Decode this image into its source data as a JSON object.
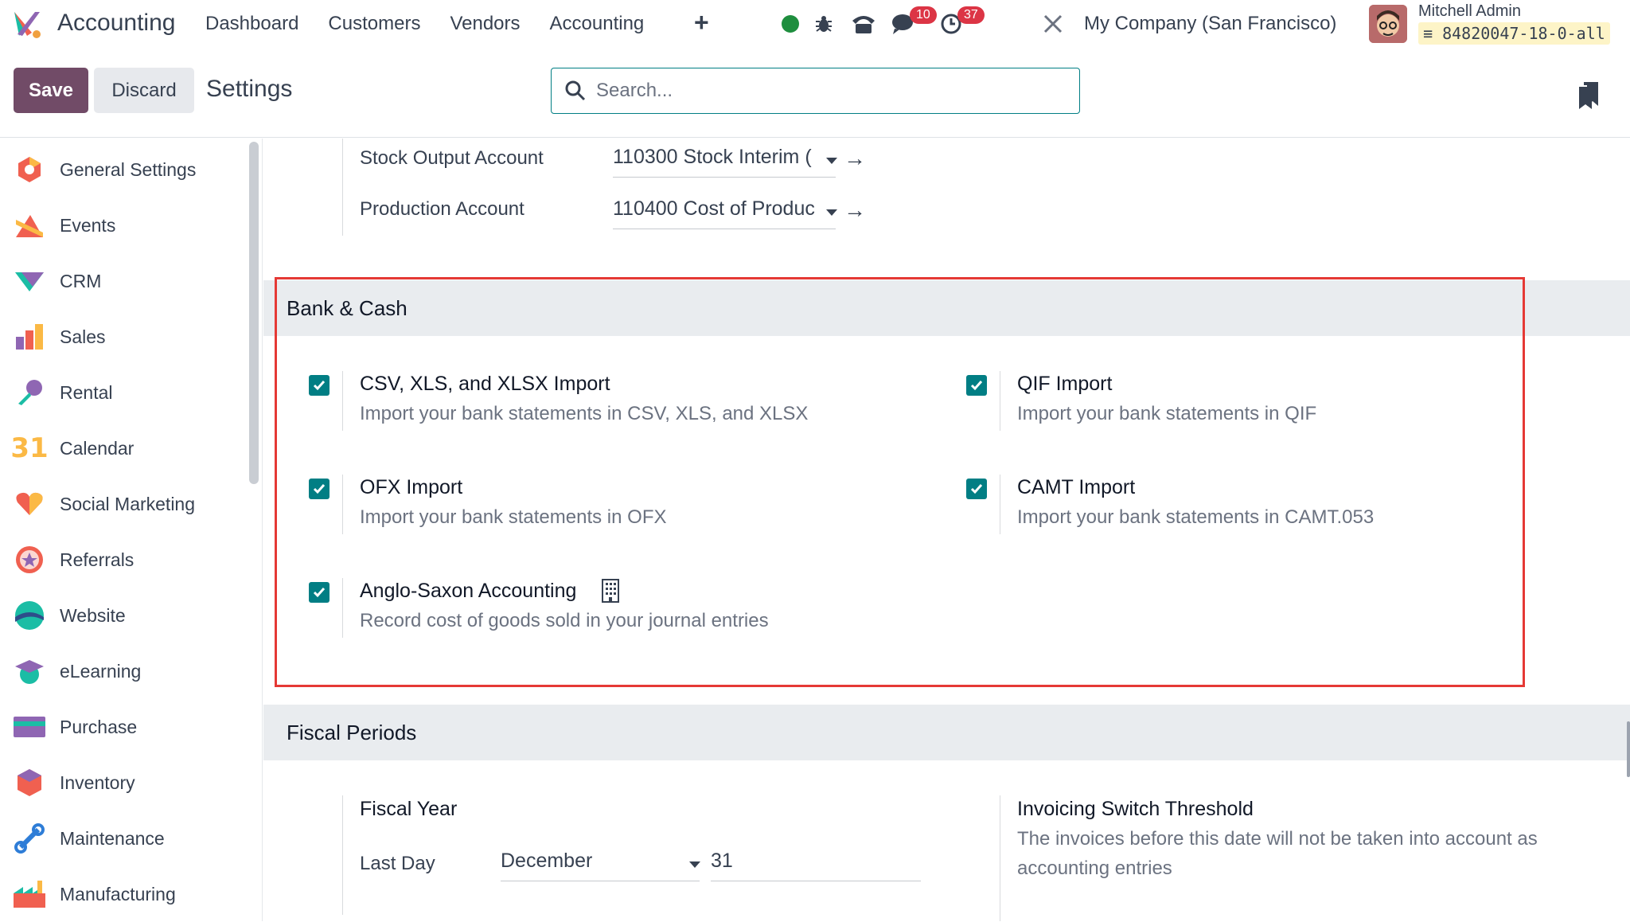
{
  "topnav": {
    "app_name": "Accounting",
    "menu": [
      "Dashboard",
      "Customers",
      "Vendors",
      "Accounting"
    ],
    "plus_icon": "plus-icon",
    "status_color": "#1e8e3e",
    "messages_badge": "10",
    "activities_badge": "37",
    "company": "My Company (San Francisco)",
    "user_name": "Mitchell Admin",
    "database": "84820047-18-0-all"
  },
  "control": {
    "save_label": "Save",
    "discard_label": "Discard",
    "breadcrumb": "Settings",
    "search_placeholder": "Search..."
  },
  "sidebar": {
    "items": [
      {
        "label": "General Settings",
        "icon": "general-settings-icon"
      },
      {
        "label": "Events",
        "icon": "events-icon"
      },
      {
        "label": "CRM",
        "icon": "crm-icon"
      },
      {
        "label": "Sales",
        "icon": "sales-icon"
      },
      {
        "label": "Rental",
        "icon": "rental-icon"
      },
      {
        "label": "Calendar",
        "icon": "calendar-icon"
      },
      {
        "label": "Social Marketing",
        "icon": "social-marketing-icon"
      },
      {
        "label": "Referrals",
        "icon": "referrals-icon"
      },
      {
        "label": "Website",
        "icon": "website-icon"
      },
      {
        "label": "eLearning",
        "icon": "elearning-icon"
      },
      {
        "label": "Purchase",
        "icon": "purchase-icon"
      },
      {
        "label": "Inventory",
        "icon": "inventory-icon"
      },
      {
        "label": "Maintenance",
        "icon": "maintenance-icon"
      },
      {
        "label": "Manufacturing",
        "icon": "manufacturing-icon"
      }
    ]
  },
  "accounts": {
    "stock_output_label": "Stock Output Account",
    "stock_output_value": "110300 Stock Interim (",
    "production_label": "Production Account",
    "production_value": "110400 Cost of Produc"
  },
  "bank_cash": {
    "title": "Bank & Cash",
    "options": [
      {
        "title": "CSV, XLS, and XLSX Import",
        "desc": "Import your bank statements in CSV, XLS, and XLSX",
        "checked": true
      },
      {
        "title": "QIF Import",
        "desc": "Import your bank statements in QIF",
        "checked": true
      },
      {
        "title": "OFX Import",
        "desc": "Import your bank statements in OFX",
        "checked": true
      },
      {
        "title": "CAMT Import",
        "desc": "Import your bank statements in CAMT.053",
        "checked": true
      },
      {
        "title": "Anglo-Saxon Accounting",
        "desc": "Record cost of goods sold in your journal entries",
        "checked": true
      }
    ]
  },
  "fiscal": {
    "title": "Fiscal Periods",
    "fiscal_year_label": "Fiscal Year",
    "last_day_label": "Last Day",
    "last_day_month": "December",
    "last_day_day": "31",
    "threshold_title": "Invoicing Switch Threshold",
    "threshold_desc_1": "The invoices before this date will not be taken into account as",
    "threshold_desc_2": "accounting entries"
  }
}
